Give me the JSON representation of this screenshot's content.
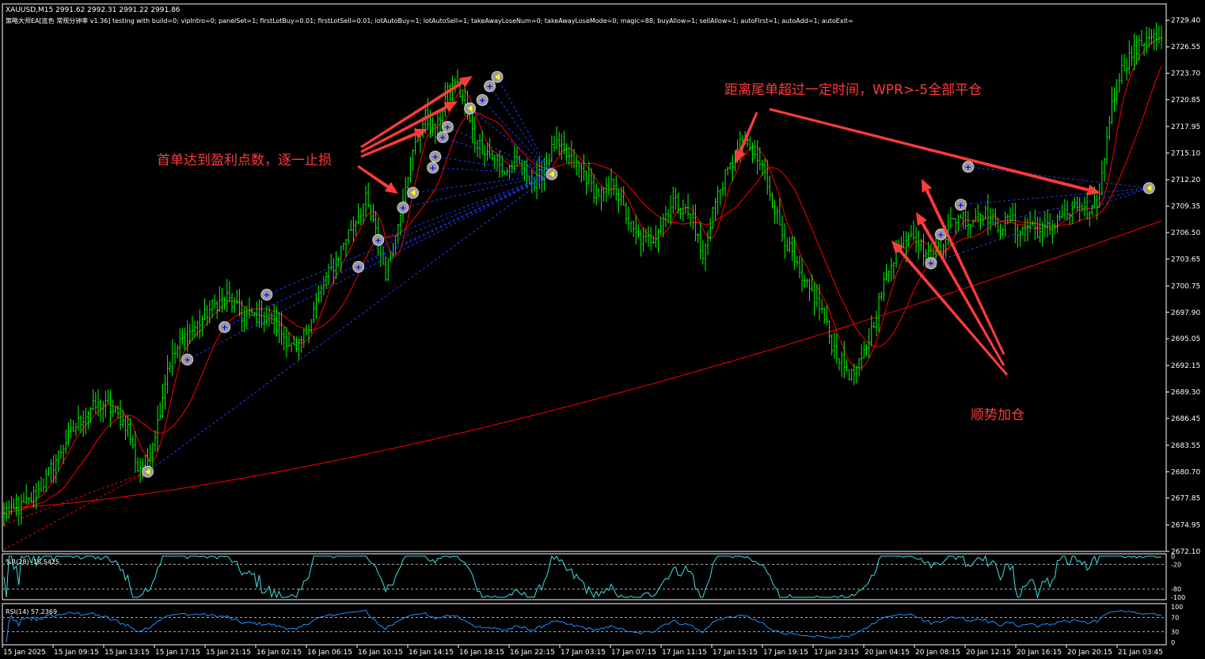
{
  "header": {
    "symbol": "XAUUSD,M15  2991.62 2992.31 2991.22 2991.86",
    "ea_info": "策略大师EA[底色 常规分钟率 v1.36] testing with build=0; vipIntro=0; panelSet=1; firstLotBuy=0.01; firstLotSell=0.01; lotAutoBuy=1; lotAutoSell=1; takeAwayLoseNum=0; takeAwayLoseMode=0; magic=88; buyAllow=1; sellAllow=1; autoFirst=1; autoAdd=1; autoExit="
  },
  "annotations": {
    "take_profit": "首单达到盈利点数，逐一止损",
    "close_all": "距离尾单超过一定时间，WPR>-5全部平仓",
    "add_position": "顺势加仓"
  },
  "wpr_label": "%R(28) -18.5425",
  "rsi_label": "RSI(14) 57.2369",
  "colors": {
    "background": "#000000",
    "candle": "#00ff00",
    "ma": "#ff0000",
    "annotation": "#ff3b3b",
    "order_line": "#1e3cff",
    "wpr_line": "#40e0e0",
    "rsi_line": "#1e90ff",
    "axis": "#ffffff"
  },
  "chart_data": {
    "type": "line",
    "title": "XAUUSD,M15",
    "price_axis": [
      "2729.40",
      "2726.55",
      "2723.70",
      "2720.85",
      "2717.95",
      "2715.10",
      "2712.20",
      "2709.35",
      "2706.50",
      "2703.65",
      "2700.75",
      "2697.90",
      "2695.05",
      "2692.15",
      "2689.30",
      "2686.45",
      "2683.55",
      "2680.70",
      "2677.85",
      "2674.95",
      "2672.10"
    ],
    "ylim": [
      2672.1,
      2731.0
    ],
    "time_axis": [
      "15 Jan 2025",
      "15 Jan 09:15",
      "15 Jan 13:15",
      "15 Jan 17:15",
      "15 Jan 21:15",
      "16 Jan 02:15",
      "16 Jan 06:15",
      "16 Jan 10:15",
      "16 Jan 14:15",
      "16 Jan 18:15",
      "16 Jan 22:15",
      "17 Jan 03:15",
      "17 Jan 07:15",
      "17 Jan 11:15",
      "17 Jan 15:15",
      "17 Jan 19:15",
      "17 Jan 23:15",
      "20 Jan 04:15",
      "20 Jan 08:15",
      "20 Jan 12:15",
      "20 Jan 16:15",
      "20 Jan 20:15",
      "21 Jan 03:45"
    ],
    "close_path": [
      [
        0,
        2676.0
      ],
      [
        5,
        2676.5
      ],
      [
        10,
        2677.5
      ],
      [
        15,
        2679.0
      ],
      [
        20,
        2681.5
      ],
      [
        25,
        2684.0
      ],
      [
        30,
        2686.0
      ],
      [
        35,
        2687.5
      ],
      [
        40,
        2688.0
      ],
      [
        45,
        2687.0
      ],
      [
        50,
        2685.5
      ],
      [
        54,
        2681.0
      ],
      [
        58,
        2682.0
      ],
      [
        62,
        2686.0
      ],
      [
        66,
        2692.0
      ],
      [
        72,
        2695.0
      ],
      [
        78,
        2696.5
      ],
      [
        84,
        2698.5
      ],
      [
        90,
        2699.5
      ],
      [
        96,
        2697.5
      ],
      [
        102,
        2697.5
      ],
      [
        108,
        2697.0
      ],
      [
        114,
        2695.0
      ],
      [
        118,
        2693.5
      ],
      [
        122,
        2696.0
      ],
      [
        126,
        2699.0
      ],
      [
        130,
        2701.5
      ],
      [
        134,
        2703.5
      ],
      [
        138,
        2706.0
      ],
      [
        142,
        2708.0
      ],
      [
        146,
        2710.0
      ],
      [
        150,
        2706.5
      ],
      [
        154,
        2702.0
      ],
      [
        158,
        2706.0
      ],
      [
        162,
        2712.0
      ],
      [
        166,
        2716.0
      ],
      [
        170,
        2719.0
      ],
      [
        174,
        2717.0
      ],
      [
        178,
        2721.0
      ],
      [
        182,
        2723.0
      ],
      [
        186,
        2720.0
      ],
      [
        190,
        2716.5
      ],
      [
        194,
        2715.5
      ],
      [
        198,
        2714.5
      ],
      [
        202,
        2713.0
      ],
      [
        206,
        2714.0
      ],
      [
        210,
        2713.5
      ],
      [
        214,
        2711.5
      ],
      [
        218,
        2713.5
      ],
      [
        222,
        2716.0
      ],
      [
        226,
        2715.0
      ],
      [
        230,
        2714.0
      ],
      [
        234,
        2713.0
      ],
      [
        238,
        2711.0
      ],
      [
        242,
        2710.5
      ],
      [
        246,
        2712.0
      ],
      [
        250,
        2709.0
      ],
      [
        254,
        2706.5
      ],
      [
        258,
        2705.5
      ],
      [
        262,
        2706.0
      ],
      [
        266,
        2708.0
      ],
      [
        270,
        2710.0
      ],
      [
        274,
        2709.0
      ],
      [
        278,
        2708.0
      ],
      [
        282,
        2703.5
      ],
      [
        286,
        2709.0
      ],
      [
        290,
        2712.0
      ],
      [
        294,
        2714.0
      ],
      [
        298,
        2716.5
      ],
      [
        302,
        2715.0
      ],
      [
        306,
        2713.5
      ],
      [
        310,
        2710.0
      ],
      [
        314,
        2706.5
      ],
      [
        318,
        2704.0
      ],
      [
        322,
        2701.0
      ],
      [
        326,
        2700.0
      ],
      [
        330,
        2698.0
      ],
      [
        334,
        2694.5
      ],
      [
        338,
        2692.5
      ],
      [
        342,
        2691.0
      ],
      [
        346,
        2692.5
      ],
      [
        350,
        2696.0
      ],
      [
        354,
        2700.0
      ],
      [
        358,
        2703.5
      ],
      [
        362,
        2705.0
      ],
      [
        366,
        2707.0
      ],
      [
        370,
        2705.0
      ],
      [
        374,
        2703.5
      ],
      [
        378,
        2705.0
      ],
      [
        382,
        2707.5
      ],
      [
        386,
        2708.5
      ],
      [
        390,
        2707.5
      ],
      [
        394,
        2709.0
      ],
      [
        398,
        2708.0
      ],
      [
        402,
        2707.0
      ],
      [
        406,
        2708.0
      ],
      [
        410,
        2706.5
      ],
      [
        414,
        2707.5
      ],
      [
        418,
        2706.5
      ],
      [
        422,
        2707.0
      ],
      [
        426,
        2708.5
      ],
      [
        430,
        2708.5
      ],
      [
        434,
        2709.5
      ],
      [
        438,
        2708.0
      ],
      [
        442,
        2710.5
      ],
      [
        446,
        2719.0
      ],
      [
        450,
        2723.5
      ],
      [
        454,
        2725.5
      ],
      [
        458,
        2726.5
      ],
      [
        462,
        2728.0
      ],
      [
        466,
        2727.2
      ]
    ],
    "n_bars": 468,
    "ma_fast_label": "",
    "ma_slow_label": "",
    "buy_markers": [
      [
        58,
        2680.7
      ],
      [
        74,
        2692.8
      ],
      [
        89,
        2696.3
      ],
      [
        106,
        2699.8
      ],
      [
        143,
        2702.8
      ],
      [
        151,
        2705.7
      ],
      [
        161,
        2709.2
      ],
      [
        165,
        2710.8
      ],
      [
        173,
        2713.5
      ],
      [
        174,
        2714.7
      ],
      [
        177,
        2716.8
      ],
      [
        179,
        2717.9
      ],
      [
        188,
        2719.9
      ],
      [
        193,
        2720.8
      ],
      [
        196,
        2722.3
      ],
      [
        199,
        2723.3
      ],
      [
        221,
        2712.8
      ],
      [
        374,
        2703.2
      ],
      [
        378,
        2706.3
      ],
      [
        386,
        2709.5
      ],
      [
        389,
        2713.6
      ],
      [
        462,
        2711.3
      ]
    ],
    "wpr": {
      "levels": [
        "0",
        "-20",
        "-80",
        "-100"
      ],
      "current": -18.5425
    },
    "rsi": {
      "levels": [
        "100",
        "70",
        "30",
        "0"
      ],
      "current": 57.2369
    }
  }
}
